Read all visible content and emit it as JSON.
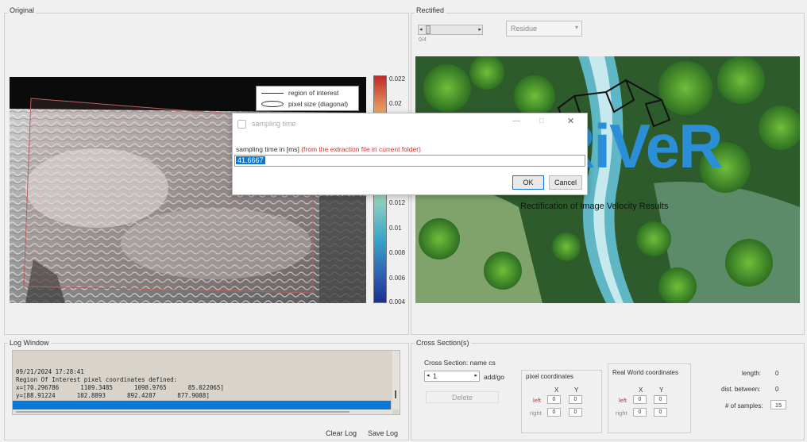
{
  "left_panel": {
    "title": "Original",
    "legend_items": [
      "region of interest",
      "pixel size (diagonal)"
    ],
    "colorbar_ticks": [
      "0.022",
      "0.02",
      "0.012",
      "0.01",
      "0.008",
      "0.006",
      "0.004"
    ]
  },
  "right_panel": {
    "title": "Rectified",
    "dropdown_value": "Residue",
    "slider_caption": "0/4",
    "logo_text": "RiVeR",
    "logo_subtitle": "Rectification of Image Velocity Results"
  },
  "dialog": {
    "title": "sampling time",
    "prompt_prefix": "sampling time in [ms]",
    "prompt_note": "(from the extraction file in current folder)",
    "input_value": "41.6667",
    "ok_label": "OK",
    "cancel_label": "Cancel"
  },
  "log_window": {
    "title": "Log Window",
    "lines": [
      "09/21/2024 17:28:41",
      "Region Of Interest pixel coordinates defined:",
      "x=[70.296786      1109.3485      1098.9765      85.022065]",
      "y=[88.91224      102.8893      892.4287      877.9088]"
    ],
    "clear_label": "Clear Log",
    "save_label": "Save Log"
  },
  "cross_sections": {
    "title": "Cross Section(s)",
    "name_label": "Cross Section: name cs",
    "spinner_value": "1",
    "spinner_suffix": "add/go",
    "delete_label": "Delete",
    "pixel_group_title": "pixel coordinates",
    "real_group_title": "Real World coordinates",
    "x_header": "X",
    "y_header": "Y",
    "left_label": "left",
    "right_label": "right",
    "pixel_left": [
      "0",
      "0"
    ],
    "pixel_right": [
      "0",
      "0"
    ],
    "real_left": [
      "0",
      "0"
    ],
    "real_right": [
      "0",
      "0"
    ],
    "length_label": "length:",
    "length_value": "0",
    "dist_label": "dist. between:",
    "dist_value": "0",
    "samples_label": "# of samples:",
    "samples_value": "15"
  },
  "colors": {
    "selection_blue": "#0a78d7",
    "prompt_red": "#cc3333",
    "logo_blue": "#2b8fd8"
  }
}
